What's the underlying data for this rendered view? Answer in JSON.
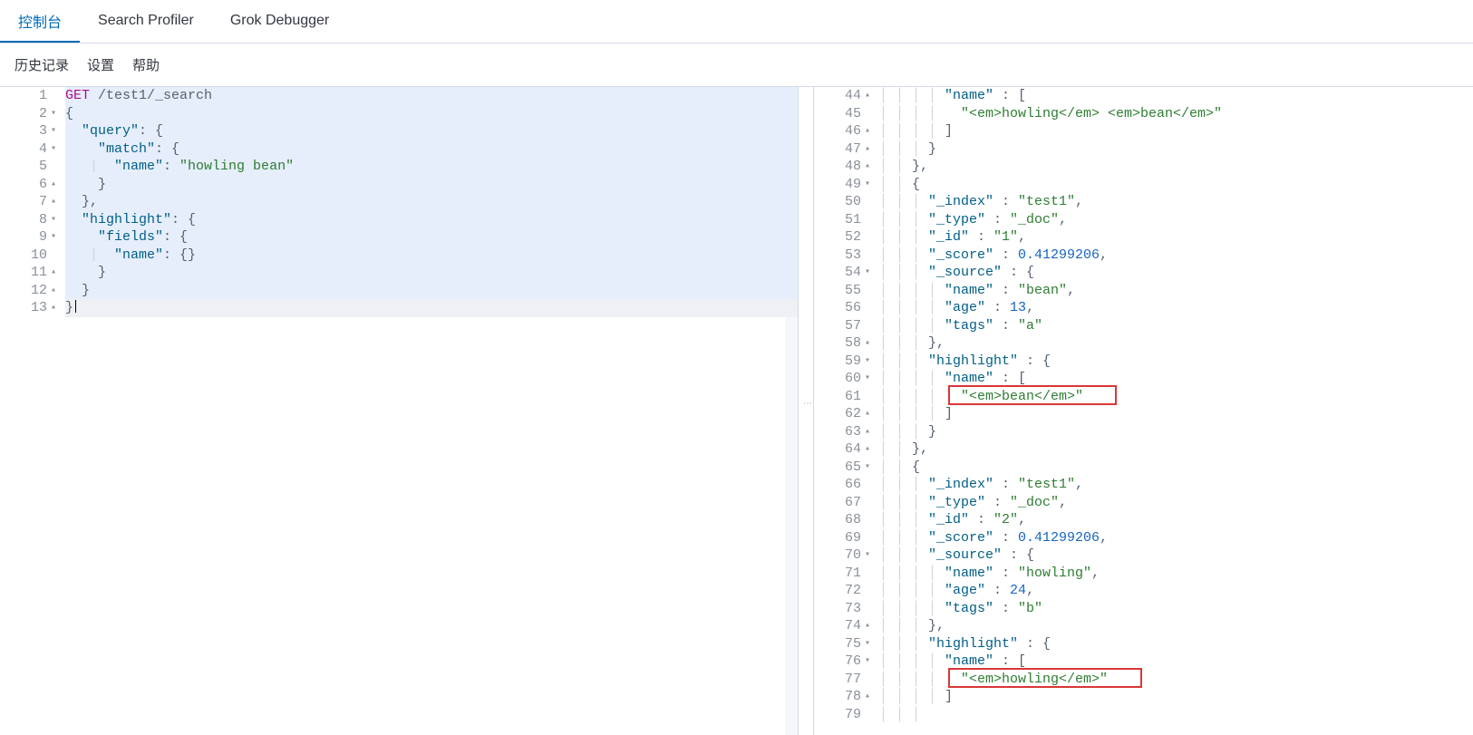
{
  "tabs": {
    "console": "控制台",
    "search_profiler": "Search Profiler",
    "grok_debugger": "Grok Debugger",
    "active": "console"
  },
  "toolbar": {
    "history": "历史记录",
    "settings": "设置",
    "help": "帮助"
  },
  "request_editor": {
    "lines": {
      "l1": {
        "num": "1",
        "method": "GET",
        "path": "/test1/_search"
      },
      "l2": {
        "num": "2",
        "raw": "{"
      },
      "l3": {
        "num": "3",
        "key": "\"query\"",
        "after": ": {"
      },
      "l4": {
        "num": "4",
        "key": "\"match\"",
        "after": ": {"
      },
      "l5": {
        "num": "5",
        "key": "\"name\"",
        "val": "\"howling bean\""
      },
      "l6": {
        "num": "6",
        "raw": "}"
      },
      "l7": {
        "num": "7",
        "raw": "},"
      },
      "l8": {
        "num": "8",
        "key": "\"highlight\"",
        "after": ": {"
      },
      "l9": {
        "num": "9",
        "key": "\"fields\"",
        "after": ": {"
      },
      "l10": {
        "num": "10",
        "key": "\"name\"",
        "after": ": {}"
      },
      "l11": {
        "num": "11",
        "raw": "}"
      },
      "l12": {
        "num": "12",
        "raw": "}"
      },
      "l13": {
        "num": "13",
        "raw": "}"
      }
    },
    "action_icons": {
      "run": "send-icon",
      "wrench": "wrench-icon"
    }
  },
  "response_editor": {
    "lines": [
      {
        "num": "44",
        "fold": "up",
        "html": [
          [
            "guide",
            "| | | | "
          ],
          [
            "key",
            "\"name\""
          ],
          [
            "punc",
            " : ["
          ]
        ]
      },
      {
        "num": "45",
        "html": [
          [
            "guide",
            "| | | |   "
          ],
          [
            "string",
            "\"<em>howling</em> <em>bean</em>\""
          ]
        ]
      },
      {
        "num": "46",
        "fold": "up",
        "html": [
          [
            "guide",
            "| | | | "
          ],
          [
            "punc",
            "]"
          ]
        ]
      },
      {
        "num": "47",
        "fold": "up",
        "html": [
          [
            "guide",
            "| | | "
          ],
          [
            "punc",
            "}"
          ]
        ]
      },
      {
        "num": "48",
        "fold": "up",
        "html": [
          [
            "guide",
            "| | "
          ],
          [
            "punc",
            "},"
          ]
        ]
      },
      {
        "num": "49",
        "fold": "down",
        "html": [
          [
            "guide",
            "| | "
          ],
          [
            "punc",
            "{"
          ]
        ]
      },
      {
        "num": "50",
        "html": [
          [
            "guide",
            "| | | "
          ],
          [
            "key",
            "\"_index\""
          ],
          [
            "punc",
            " : "
          ],
          [
            "string",
            "\"test1\""
          ],
          [
            "punc",
            ","
          ]
        ]
      },
      {
        "num": "51",
        "html": [
          [
            "guide",
            "| | | "
          ],
          [
            "key",
            "\"_type\""
          ],
          [
            "punc",
            " : "
          ],
          [
            "string",
            "\"_doc\""
          ],
          [
            "punc",
            ","
          ]
        ]
      },
      {
        "num": "52",
        "html": [
          [
            "guide",
            "| | | "
          ],
          [
            "key",
            "\"_id\""
          ],
          [
            "punc",
            " : "
          ],
          [
            "string",
            "\"1\""
          ],
          [
            "punc",
            ","
          ]
        ]
      },
      {
        "num": "53",
        "html": [
          [
            "guide",
            "| | | "
          ],
          [
            "key",
            "\"_score\""
          ],
          [
            "punc",
            " : "
          ],
          [
            "number",
            "0.41299206"
          ],
          [
            "punc",
            ","
          ]
        ]
      },
      {
        "num": "54",
        "fold": "down",
        "html": [
          [
            "guide",
            "| | | "
          ],
          [
            "key",
            "\"_source\""
          ],
          [
            "punc",
            " : {"
          ]
        ]
      },
      {
        "num": "55",
        "html": [
          [
            "guide",
            "| | | | "
          ],
          [
            "key",
            "\"name\""
          ],
          [
            "punc",
            " : "
          ],
          [
            "string",
            "\"bean\""
          ],
          [
            "punc",
            ","
          ]
        ]
      },
      {
        "num": "56",
        "html": [
          [
            "guide",
            "| | | | "
          ],
          [
            "key",
            "\"age\""
          ],
          [
            "punc",
            " : "
          ],
          [
            "number",
            "13"
          ],
          [
            "punc",
            ","
          ]
        ]
      },
      {
        "num": "57",
        "html": [
          [
            "guide",
            "| | | | "
          ],
          [
            "key",
            "\"tags\""
          ],
          [
            "punc",
            " : "
          ],
          [
            "string",
            "\"a\""
          ]
        ]
      },
      {
        "num": "58",
        "fold": "up",
        "html": [
          [
            "guide",
            "| | | "
          ],
          [
            "punc",
            "},"
          ]
        ]
      },
      {
        "num": "59",
        "fold": "down",
        "html": [
          [
            "guide",
            "| | | "
          ],
          [
            "key",
            "\"highlight\""
          ],
          [
            "punc",
            " : {"
          ]
        ]
      },
      {
        "num": "60",
        "fold": "down",
        "html": [
          [
            "guide",
            "| | | | "
          ],
          [
            "key",
            "\"name\""
          ],
          [
            "punc",
            " : ["
          ]
        ]
      },
      {
        "num": "61",
        "html": [
          [
            "guide",
            "| | | |   "
          ],
          [
            "string",
            "\"<em>bean</em>\""
          ]
        ]
      },
      {
        "num": "62",
        "fold": "up",
        "html": [
          [
            "guide",
            "| | | | "
          ],
          [
            "punc",
            "]"
          ]
        ]
      },
      {
        "num": "63",
        "fold": "up",
        "html": [
          [
            "guide",
            "| | | "
          ],
          [
            "punc",
            "}"
          ]
        ]
      },
      {
        "num": "64",
        "fold": "up",
        "html": [
          [
            "guide",
            "| | "
          ],
          [
            "punc",
            "},"
          ]
        ]
      },
      {
        "num": "65",
        "fold": "down",
        "html": [
          [
            "guide",
            "| | "
          ],
          [
            "punc",
            "{"
          ]
        ]
      },
      {
        "num": "66",
        "html": [
          [
            "guide",
            "| | | "
          ],
          [
            "key",
            "\"_index\""
          ],
          [
            "punc",
            " : "
          ],
          [
            "string",
            "\"test1\""
          ],
          [
            "punc",
            ","
          ]
        ]
      },
      {
        "num": "67",
        "html": [
          [
            "guide",
            "| | | "
          ],
          [
            "key",
            "\"_type\""
          ],
          [
            "punc",
            " : "
          ],
          [
            "string",
            "\"_doc\""
          ],
          [
            "punc",
            ","
          ]
        ]
      },
      {
        "num": "68",
        "html": [
          [
            "guide",
            "| | | "
          ],
          [
            "key",
            "\"_id\""
          ],
          [
            "punc",
            " : "
          ],
          [
            "string",
            "\"2\""
          ],
          [
            "punc",
            ","
          ]
        ]
      },
      {
        "num": "69",
        "html": [
          [
            "guide",
            "| | | "
          ],
          [
            "key",
            "\"_score\""
          ],
          [
            "punc",
            " : "
          ],
          [
            "number",
            "0.41299206"
          ],
          [
            "punc",
            ","
          ]
        ]
      },
      {
        "num": "70",
        "fold": "down",
        "html": [
          [
            "guide",
            "| | | "
          ],
          [
            "key",
            "\"_source\""
          ],
          [
            "punc",
            " : {"
          ]
        ]
      },
      {
        "num": "71",
        "html": [
          [
            "guide",
            "| | | | "
          ],
          [
            "key",
            "\"name\""
          ],
          [
            "punc",
            " : "
          ],
          [
            "string",
            "\"howling\""
          ],
          [
            "punc",
            ","
          ]
        ]
      },
      {
        "num": "72",
        "html": [
          [
            "guide",
            "| | | | "
          ],
          [
            "key",
            "\"age\""
          ],
          [
            "punc",
            " : "
          ],
          [
            "number",
            "24"
          ],
          [
            "punc",
            ","
          ]
        ]
      },
      {
        "num": "73",
        "html": [
          [
            "guide",
            "| | | | "
          ],
          [
            "key",
            "\"tags\""
          ],
          [
            "punc",
            " : "
          ],
          [
            "string",
            "\"b\""
          ]
        ]
      },
      {
        "num": "74",
        "fold": "up",
        "html": [
          [
            "guide",
            "| | | "
          ],
          [
            "punc",
            "},"
          ]
        ]
      },
      {
        "num": "75",
        "fold": "down",
        "html": [
          [
            "guide",
            "| | | "
          ],
          [
            "key",
            "\"highlight\""
          ],
          [
            "punc",
            " : {"
          ]
        ]
      },
      {
        "num": "76",
        "fold": "down",
        "html": [
          [
            "guide",
            "| | | | "
          ],
          [
            "key",
            "\"name\""
          ],
          [
            "punc",
            " : ["
          ]
        ]
      },
      {
        "num": "77",
        "html": [
          [
            "guide",
            "| | | |   "
          ],
          [
            "string",
            "\"<em>howling</em>\""
          ]
        ]
      },
      {
        "num": "78",
        "fold": "up",
        "html": [
          [
            "guide",
            "| | | | "
          ],
          [
            "punc",
            "]"
          ]
        ]
      },
      {
        "num": "79",
        "html": [
          [
            "guide",
            "| | | "
          ],
          [
            "punc",
            ""
          ]
        ]
      }
    ]
  }
}
